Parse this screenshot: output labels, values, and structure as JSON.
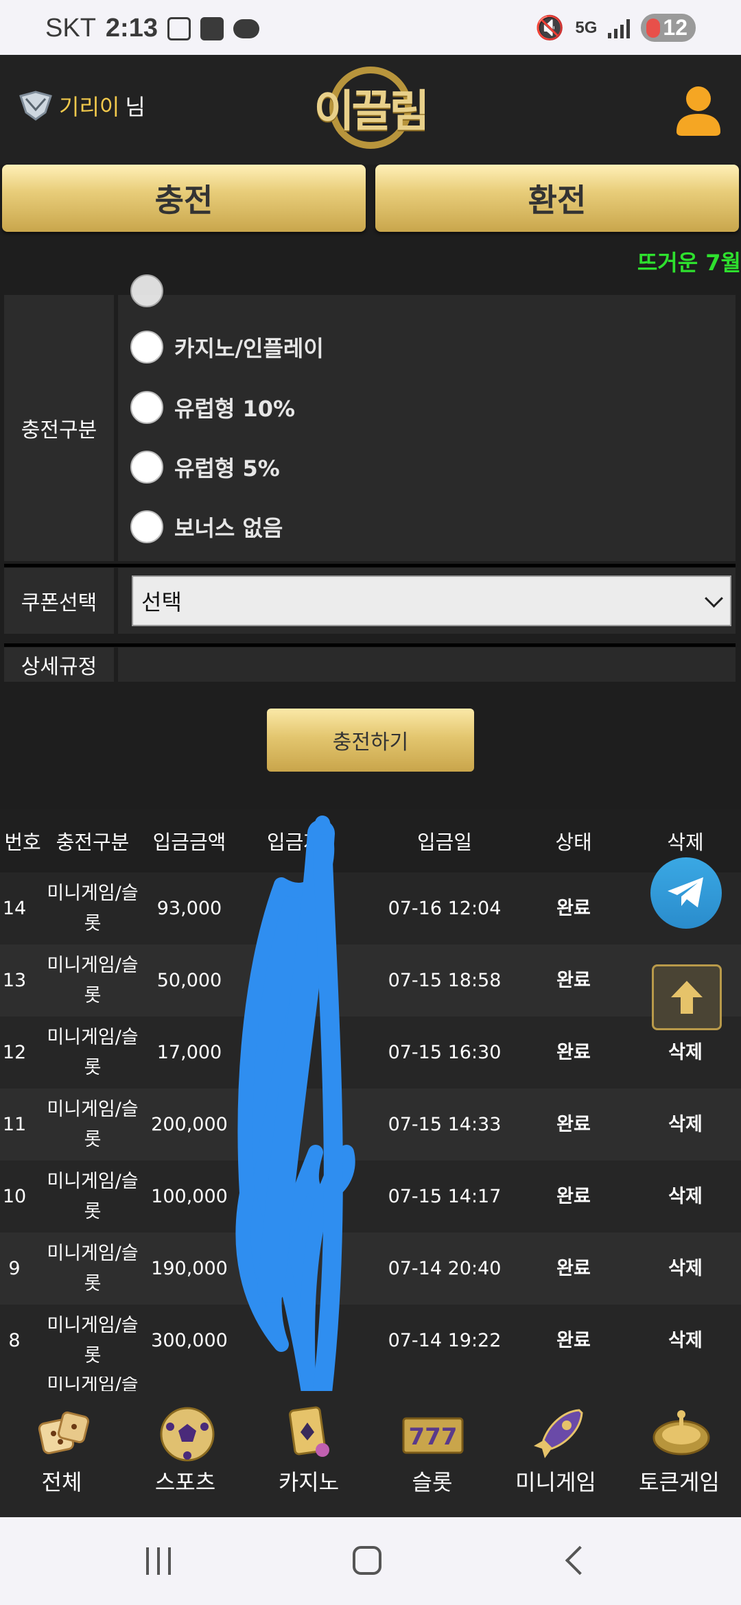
{
  "status_bar": {
    "carrier": "SKT",
    "time": "2:13",
    "network": "5G",
    "battery": "12"
  },
  "header": {
    "username": "기리이",
    "username_suffix": "님",
    "logo_text": "이끌림"
  },
  "actions": {
    "charge": "충전",
    "exchange": "환전"
  },
  "ticker": "뜨거운 7월",
  "form": {
    "charge_type_label": "충전구분",
    "options": [
      {
        "label": "카지노/인플레이",
        "selected": false
      },
      {
        "label": "유럽형 10%",
        "selected": false
      },
      {
        "label": "유럽형 5%",
        "selected": false
      },
      {
        "label": "보너스 없음",
        "selected": false
      }
    ],
    "coupon_label": "쿠폰선택",
    "coupon_value": "선택",
    "rules_label": "상세규정",
    "submit": "충전하기"
  },
  "table": {
    "headers": [
      "번호",
      "충전구분",
      "입금금액",
      "입금자",
      "입금일",
      "상태",
      "삭제"
    ],
    "rows": [
      {
        "no": "14",
        "type_line1": "미니게임/슬",
        "type_line2": "롯",
        "amount": "93,000",
        "depositor": "",
        "date": "07-16 12:04",
        "status": "완료",
        "delete": ""
      },
      {
        "no": "13",
        "type_line1": "미니게임/슬",
        "type_line2": "롯",
        "amount": "50,000",
        "depositor": "*",
        "date": "07-15 18:58",
        "status": "완료",
        "delete": ""
      },
      {
        "no": "12",
        "type_line1": "미니게임/슬",
        "type_line2": "롯",
        "amount": "17,000",
        "depositor": "",
        "date": "07-15 16:30",
        "status": "완료",
        "delete": "삭제"
      },
      {
        "no": "11",
        "type_line1": "미니게임/슬",
        "type_line2": "롯",
        "amount": "200,000",
        "depositor": "",
        "date": "07-15 14:33",
        "status": "완료",
        "delete": "삭제"
      },
      {
        "no": "10",
        "type_line1": "미니게임/슬",
        "type_line2": "롯",
        "amount": "100,000",
        "depositor": "",
        "date": "07-15 14:17",
        "status": "완료",
        "delete": "삭제"
      },
      {
        "no": "9",
        "type_line1": "미니게임/슬",
        "type_line2": "롯",
        "amount": "190,000",
        "depositor": "*",
        "date": "07-14 20:40",
        "status": "완료",
        "delete": "삭제"
      },
      {
        "no": "8",
        "type_line1": "미니게임/슬",
        "type_line2": "롯",
        "amount": "300,000",
        "depositor": "",
        "date": "07-14 19:22",
        "status": "완료",
        "delete": "삭제"
      }
    ],
    "partial_row_type": "미니게임/슬"
  },
  "bottom_nav": [
    {
      "label": "전체",
      "icon": "dice-icon"
    },
    {
      "label": "스포츠",
      "icon": "soccer-ball-icon"
    },
    {
      "label": "카지노",
      "icon": "cards-icon"
    },
    {
      "label": "슬롯",
      "icon": "slot-777-icon"
    },
    {
      "label": "미니게임",
      "icon": "rocket-icon"
    },
    {
      "label": "토큰게임",
      "icon": "roulette-icon"
    }
  ],
  "colors": {
    "gold": "#e3c66f",
    "ticker_green": "#2ee02e",
    "username_yellow": "#f2c94c",
    "telegram_blue": "#2a8ccc",
    "scribble_blue": "#2f8ef0"
  }
}
